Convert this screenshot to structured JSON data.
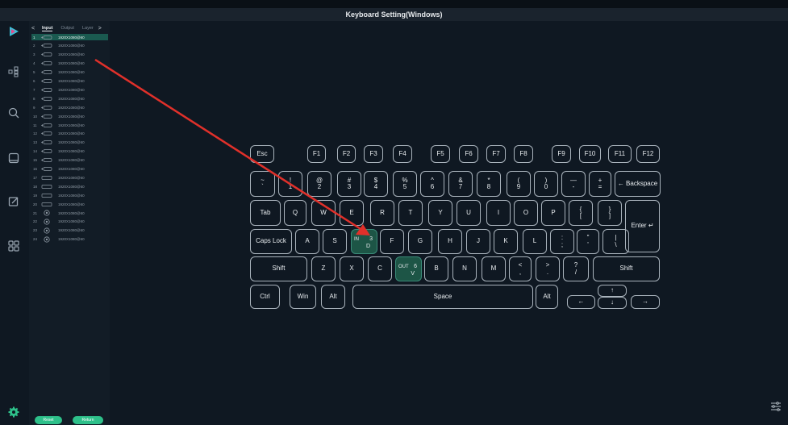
{
  "window": {
    "title": "Keyboard Setting(Windows)"
  },
  "panel": {
    "tabs": [
      {
        "label": "Input"
      },
      {
        "label": "Output"
      },
      {
        "label": "Layer"
      }
    ],
    "rows": [
      {
        "num": "1",
        "res": "1920X1080@60",
        "selected": true,
        "type": "hdmi"
      },
      {
        "num": "2",
        "res": "1920X1080@60",
        "type": "hdmi"
      },
      {
        "num": "3",
        "res": "1920X1080@60",
        "type": "hdmi"
      },
      {
        "num": "4",
        "res": "1920X1080@60",
        "type": "hdmi"
      },
      {
        "num": "5",
        "res": "1920X1080@60",
        "type": "hdmi"
      },
      {
        "num": "6",
        "res": "1920X1080@60",
        "type": "hdmi"
      },
      {
        "num": "7",
        "res": "1920X1080@60",
        "type": "hdmi"
      },
      {
        "num": "8",
        "res": "1920X1080@60",
        "type": "hdmi"
      },
      {
        "num": "9",
        "res": "1920X1080@60",
        "type": "hdmi"
      },
      {
        "num": "10",
        "res": "1920X1080@60",
        "type": "hdmi"
      },
      {
        "num": "11",
        "res": "1920X1080@60",
        "type": "hdmi"
      },
      {
        "num": "12",
        "res": "1920X1080@60",
        "type": "hdmi"
      },
      {
        "num": "13",
        "res": "1920X1080@60",
        "type": "hdmi"
      },
      {
        "num": "14",
        "res": "1920X1080@60",
        "type": "hdmi"
      },
      {
        "num": "15",
        "res": "1920X1080@60",
        "type": "hdmi"
      },
      {
        "num": "16",
        "res": "1920X1080@60",
        "type": "hdmi"
      },
      {
        "num": "17",
        "res": "1920X1080@60",
        "type": "dvi"
      },
      {
        "num": "18",
        "res": "1920X1080@60",
        "type": "dvi"
      },
      {
        "num": "19",
        "res": "1920X1080@60",
        "type": "dvi"
      },
      {
        "num": "20",
        "res": "1920X1080@60",
        "type": "dvi"
      },
      {
        "num": "21",
        "res": "1920X1080@60",
        "type": "sdi"
      },
      {
        "num": "22",
        "res": "1920X1080@60",
        "type": "sdi"
      },
      {
        "num": "23",
        "res": "1920X1080@60",
        "type": "sdi"
      },
      {
        "num": "24",
        "res": "1920X1080@60",
        "type": "sdi"
      }
    ],
    "reset_label": "Reset",
    "return_label": "Return"
  },
  "rail_icons": [
    "play-logo-icon",
    "layers-tree-icon",
    "search-icon",
    "window-icon",
    "edit-icon",
    "grid-icon",
    "gear-icon"
  ],
  "keyboard": {
    "rows": [
      [
        {
          "label": "Esc"
        },
        {
          "label": "F1"
        },
        {
          "label": "F2"
        },
        {
          "label": "F3"
        },
        {
          "label": "F4"
        },
        {
          "label": "F5"
        },
        {
          "label": "F6"
        },
        {
          "label": "F7"
        },
        {
          "label": "F8"
        },
        {
          "label": "F9"
        },
        {
          "label": "F10"
        },
        {
          "label": "F11"
        },
        {
          "label": "F12"
        }
      ],
      [
        {
          "top": "~",
          "bottom": "`"
        },
        {
          "top": "!",
          "bottom": "1"
        },
        {
          "top": "@",
          "bottom": "2"
        },
        {
          "top": "#",
          "bottom": "3"
        },
        {
          "top": "$",
          "bottom": "4"
        },
        {
          "top": "%",
          "bottom": "5"
        },
        {
          "top": "^",
          "bottom": "6"
        },
        {
          "top": "&",
          "bottom": "7"
        },
        {
          "top": "*",
          "bottom": "8"
        },
        {
          "top": "(",
          "bottom": "9"
        },
        {
          "top": ")",
          "bottom": "0"
        },
        {
          "top": "—",
          "bottom": "-"
        },
        {
          "top": "+",
          "bottom": "="
        },
        {
          "label": "← Backspace"
        }
      ],
      [
        {
          "label": "Tab"
        },
        {
          "label": "Q"
        },
        {
          "label": "W"
        },
        {
          "label": "E"
        },
        {
          "label": "R"
        },
        {
          "label": "T"
        },
        {
          "label": "Y"
        },
        {
          "label": "U"
        },
        {
          "label": "I"
        },
        {
          "label": "O"
        },
        {
          "label": "P"
        },
        {
          "top": "{",
          "bottom": "["
        },
        {
          "top": "}",
          "bottom": "]"
        },
        {
          "label": "Enter ↵"
        }
      ],
      [
        {
          "label": "Caps Lock"
        },
        {
          "label": "A"
        },
        {
          "label": "S"
        },
        {
          "tag": "IN",
          "num": "3",
          "letter": "D",
          "highlight": true
        },
        {
          "label": "F"
        },
        {
          "label": "G"
        },
        {
          "label": "H"
        },
        {
          "label": "J"
        },
        {
          "label": "K"
        },
        {
          "label": "L"
        },
        {
          "top": ":",
          "bottom": ";"
        },
        {
          "top": "\"",
          "bottom": "'"
        },
        {
          "top": "|",
          "bottom": "\\"
        }
      ],
      [
        {
          "label": "Shift"
        },
        {
          "label": "Z"
        },
        {
          "label": "X"
        },
        {
          "label": "C"
        },
        {
          "tag": "OUT",
          "num": "6",
          "letter": "V",
          "highlight": true
        },
        {
          "label": "B"
        },
        {
          "label": "N"
        },
        {
          "label": "M"
        },
        {
          "top": "<",
          "bottom": ","
        },
        {
          "top": ">",
          "bottom": "."
        },
        {
          "top": "?",
          "bottom": "/"
        },
        {
          "label": "Shift"
        }
      ],
      [
        {
          "label": "Ctrl"
        },
        {
          "label": "Win"
        },
        {
          "label": "Alt"
        },
        {
          "label": "Space"
        },
        {
          "label": "Alt"
        },
        {
          "label": "←"
        },
        {
          "label": "↑"
        },
        {
          "label": "↓"
        },
        {
          "label": "→"
        }
      ]
    ]
  },
  "colors": {
    "accent": "#2ec08a",
    "selected_row": "#1a5a50",
    "key_highlight": "#1d5546",
    "arrow": "#e0302a",
    "bg": "#0f1822"
  }
}
